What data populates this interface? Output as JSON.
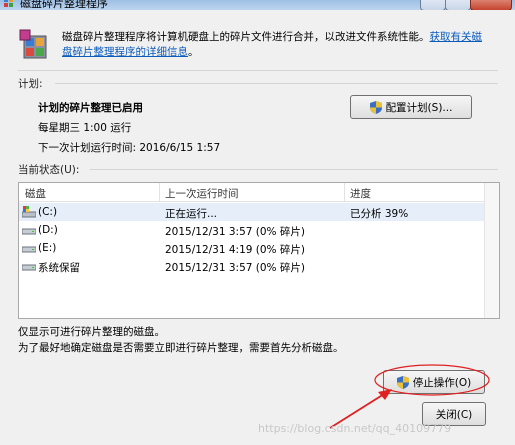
{
  "window": {
    "title": "磁盘碎片整理程序"
  },
  "header": {
    "description": "磁盘碎片整理程序将计算机硬盘上的碎片文件进行合并，以改进文件系统性能。",
    "link": "获取有关磁盘碎片整理程序的详细信息",
    "link_suffix": "。"
  },
  "schedule": {
    "section_label": "计划:",
    "status": "计划的碎片整理已启用",
    "frequency": "每星期三  1:00 运行",
    "next_run": "下一次计划运行时间: 2016/6/15 1:57",
    "configure_button": "配置计划(S)..."
  },
  "current_status": {
    "section_label": "当前状态(U):",
    "columns": [
      "磁盘",
      "上一次运行时间",
      "进度"
    ],
    "rows": [
      {
        "disk": "(C:)",
        "last_run": "正在运行...",
        "progress": "已分析 39%",
        "icon": "system-drive-icon"
      },
      {
        "disk": "(D:)",
        "last_run": "2015/12/31 3:57 (0% 碎片)",
        "progress": "",
        "icon": "drive-icon"
      },
      {
        "disk": "(E:)",
        "last_run": "2015/12/31 4:19 (0% 碎片)",
        "progress": "",
        "icon": "drive-icon"
      },
      {
        "disk": "系统保留",
        "last_run": "2015/12/31 3:57 (0% 碎片)",
        "progress": "",
        "icon": "drive-icon"
      }
    ]
  },
  "footer": {
    "note1": "仅显示可进行碎片整理的磁盘。",
    "note2": "为了最好地确定磁盘是否需要立即进行碎片整理，需要首先分析磁盘。",
    "stop_button": "停止操作(O)",
    "close_button": "关闭(C)"
  },
  "watermark": "https://blog.csdn.net/qq_40109779",
  "colors": {
    "link": "#0b5bbd",
    "annotation": "#e02020",
    "selection": "#e5eef9"
  }
}
